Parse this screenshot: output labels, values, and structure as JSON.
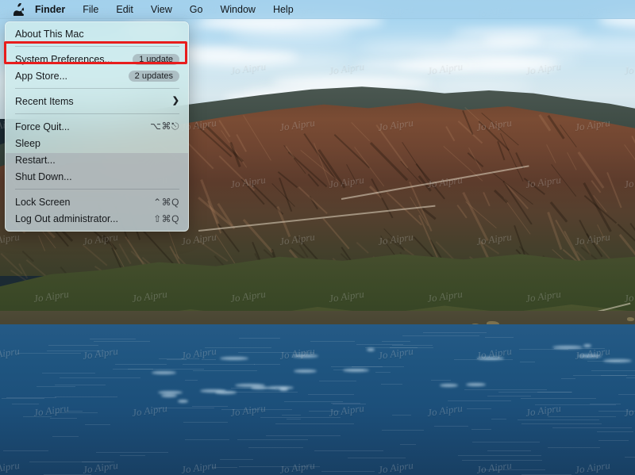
{
  "menubar": {
    "apple_icon": "apple-logo-icon",
    "items": [
      {
        "label": "Finder",
        "bold": true
      },
      {
        "label": "File",
        "bold": false
      },
      {
        "label": "Edit",
        "bold": false
      },
      {
        "label": "View",
        "bold": false
      },
      {
        "label": "Go",
        "bold": false
      },
      {
        "label": "Window",
        "bold": false
      },
      {
        "label": "Help",
        "bold": false
      }
    ]
  },
  "apple_menu": {
    "items": [
      {
        "label": "About This Mac",
        "shortcut": "",
        "badge": "",
        "chevron": "",
        "highlighted": false
      },
      {
        "label": "System Preferences...",
        "shortcut": "",
        "badge": "1 update",
        "chevron": "",
        "highlighted": true
      },
      {
        "label": "App Store...",
        "shortcut": "",
        "badge": "2 updates",
        "chevron": "",
        "highlighted": false
      },
      {
        "label": "Recent Items",
        "shortcut": "",
        "badge": "",
        "chevron": "❯",
        "highlighted": false
      },
      {
        "label": "Force Quit...",
        "shortcut": "⌥⌘⎋",
        "badge": "",
        "chevron": "",
        "highlighted": false
      },
      {
        "label": "Sleep",
        "shortcut": "",
        "badge": "",
        "chevron": "",
        "highlighted": false
      },
      {
        "label": "Restart...",
        "shortcut": "",
        "badge": "",
        "chevron": "",
        "highlighted": false
      },
      {
        "label": "Shut Down...",
        "shortcut": "",
        "badge": "",
        "chevron": "",
        "highlighted": false
      },
      {
        "label": "Lock Screen",
        "shortcut": "⌃⌘Q",
        "badge": "",
        "chevron": "",
        "highlighted": false
      },
      {
        "label": "Log Out administrator...",
        "shortcut": "⇧⌘Q",
        "badge": "",
        "chevron": "",
        "highlighted": false
      }
    ],
    "separator_after_indices": [
      0,
      2,
      3,
      7
    ]
  },
  "annotation": {
    "highlight_color": "#e81d1d",
    "target": "System Preferences..."
  },
  "desktop": {
    "wallpaper_name": "big-sur-coastline",
    "watermark_text": "Jo Aipru"
  }
}
